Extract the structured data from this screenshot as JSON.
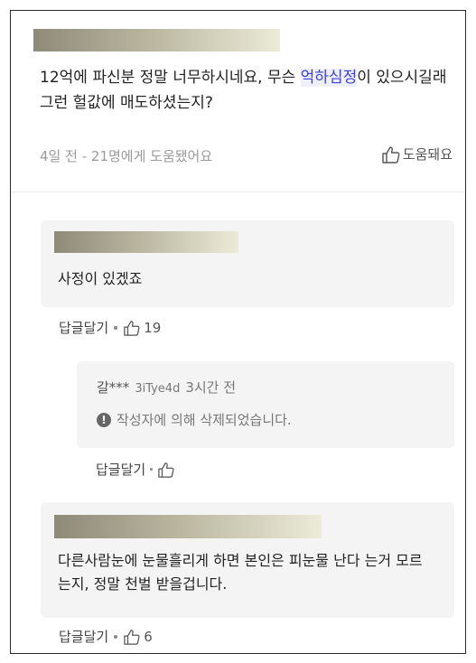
{
  "main_comment": {
    "text_before": "12억에 파신분 정말 너무하시네요, 무슨 ",
    "highlight": "억하심정",
    "text_after": "이 있으시길래 그런 헐값에 매도하셨는지?",
    "time": "4일 전",
    "separator": "-",
    "helpful_count_text": "21명에게 도움됐어요",
    "helpful_button": "도움돼요"
  },
  "replies": [
    {
      "text": "사정이 있겠죠",
      "reply_label": "답글달기",
      "likes": "19"
    },
    {
      "nickname": "갈***",
      "user_id": "3iTye4d",
      "time": "3시간 전",
      "deleted_text": "작성자에 의해 삭제되었습니다.",
      "warn_glyph": "!",
      "reply_label": "답글달기",
      "likes": ""
    },
    {
      "text": "다른사람눈에 눈물흘리게 하면 본인은 피눈물 난다 는거 모르는지, 정말 천벌 받을겁니다.",
      "reply_label": "답글달기",
      "likes": "6"
    }
  ],
  "colors": {
    "highlight": "#3f3fe0",
    "box_bg": "#f4f4f5"
  }
}
